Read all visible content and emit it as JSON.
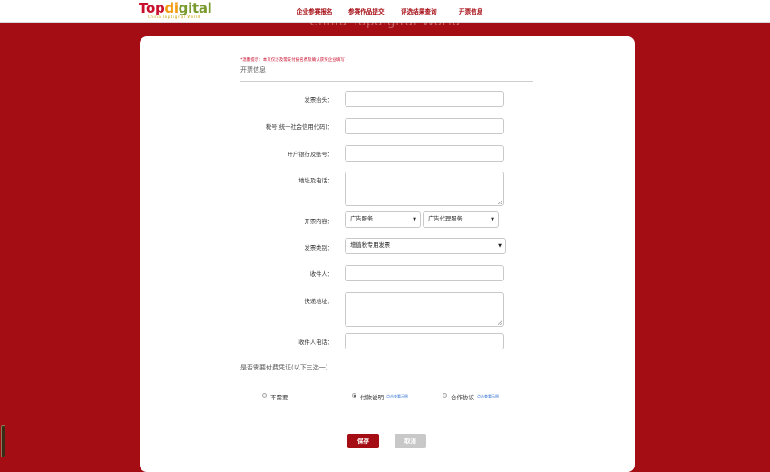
{
  "header": {
    "logo": {
      "part1": "Top",
      "part2": "di",
      "part3": "gital",
      "subtitle": "China Topdigital World"
    },
    "nav": [
      {
        "label": "企业参赛报名"
      },
      {
        "label": "参赛作品提交"
      },
      {
        "label": "评选结果查询"
      },
      {
        "label": "开票信息"
      }
    ],
    "background_caption": "China Topdigital World"
  },
  "form": {
    "tip": "*温馨提示：本页仅涉及需支付报名费及确认获奖企业填写",
    "section_title": "开票信息",
    "fields": {
      "title": {
        "label": "发票抬头：",
        "value": ""
      },
      "tax_id": {
        "label": "税号(统一社会信用代码)：",
        "value": ""
      },
      "bank": {
        "label": "开户银行及账号：",
        "value": ""
      },
      "address_phone": {
        "label": "地址及电话：",
        "value": ""
      },
      "content": {
        "label": "开票内容：",
        "select1": "广告服务",
        "select2": "广告代理服务"
      },
      "invoice_type": {
        "label": "发票类别：",
        "selected": "增值税专用发票"
      },
      "recipient": {
        "label": "收件人：",
        "value": ""
      },
      "express_address": {
        "label": "快递地址：",
        "value": ""
      },
      "recipient_phone": {
        "label": "收件人电话：",
        "value": ""
      }
    },
    "voucher_title": "是否需要付费凭证(以下三选一)",
    "voucher_options": [
      {
        "label": "不需要",
        "checked": false,
        "link": ""
      },
      {
        "label": "付款说明",
        "checked": true,
        "link": "点击查看示例"
      },
      {
        "label": "合作协议",
        "checked": false,
        "link": "点击查看示例"
      }
    ],
    "buttons": {
      "save": "保存",
      "cancel": "取消"
    }
  },
  "colors": {
    "brand_red": "#a50d14",
    "cancel_gray": "#c8c8c8",
    "link_blue": "#2a6bd1"
  }
}
